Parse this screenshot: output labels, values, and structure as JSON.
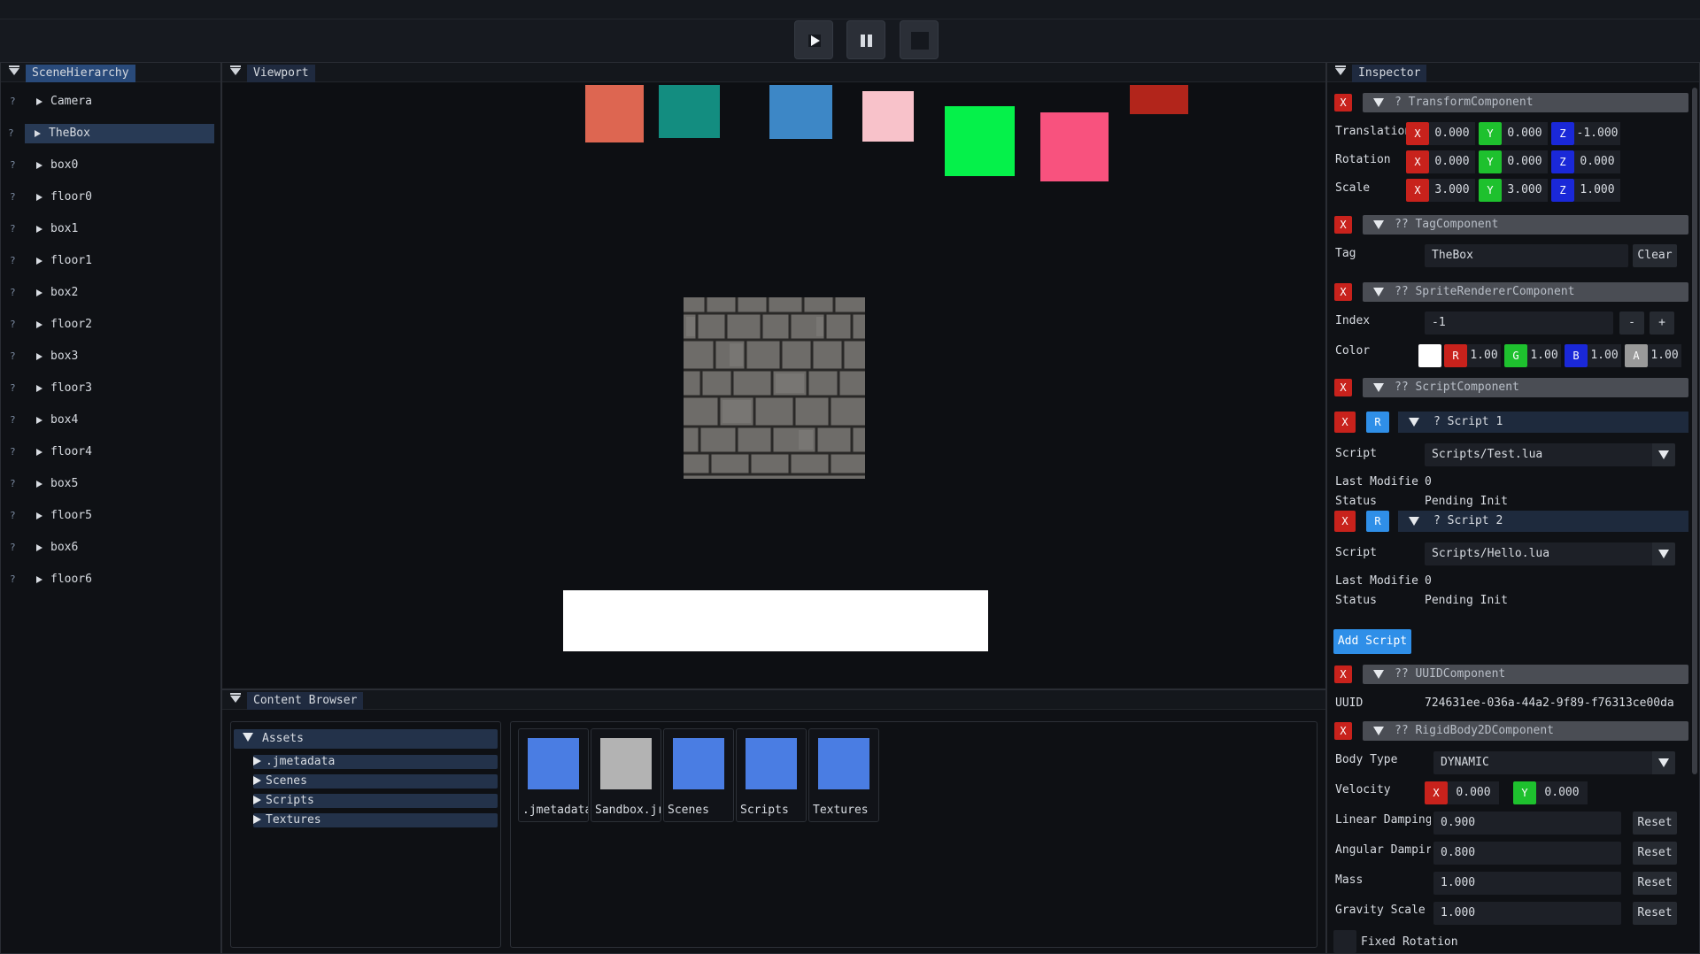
{
  "toolbar": {
    "buttons": [
      "play",
      "pause",
      "stop"
    ]
  },
  "hierarchy": {
    "tab": "SceneHierarchy",
    "row_marker": "?",
    "items": [
      "Camera",
      "TheBox",
      "box0",
      "floor0",
      "box1",
      "floor1",
      "box2",
      "floor2",
      "box3",
      "floor3",
      "box4",
      "floor4",
      "box5",
      "floor5",
      "box6",
      "floor6"
    ],
    "selected": "TheBox"
  },
  "viewport": {
    "tab": "Viewport",
    "colors": {
      "sq1": "#dd6651",
      "sq2": "#138d80",
      "sq3": "#3d87c6",
      "sq4": "#f8c2ca",
      "sq5": "#05f14a",
      "sq6": "#f8527e",
      "sq7": "#b2251b",
      "floor": "#ffffff"
    }
  },
  "content_browser": {
    "tab": "Content Browser",
    "tree": {
      "root": "Assets",
      "children": [
        ".jmetadata",
        "Scenes",
        "Scripts",
        "Textures"
      ]
    },
    "tiles": [
      {
        "label": ".jmetadata",
        "color": "#4a7de3"
      },
      {
        "label": "Sandbox.jreg",
        "color": "#b3b3b3"
      },
      {
        "label": "Scenes",
        "color": "#4a7de3"
      },
      {
        "label": "Scripts",
        "color": "#4a7de3"
      },
      {
        "label": "Textures",
        "color": "#4a7de3"
      }
    ]
  },
  "inspector": {
    "tab": "Inspector",
    "remove_label": "X",
    "transform": {
      "title": "? TransformComponent",
      "translation_label": "Translation",
      "rotation_label": "Rotation",
      "scale_label": "Scale",
      "axis_x": "X",
      "axis_y": "Y",
      "axis_z": "Z",
      "translation": [
        "0.000",
        "0.000",
        "-1.000"
      ],
      "rotation": [
        "0.000",
        "0.000",
        "0.000"
      ],
      "scale": [
        "3.000",
        "3.000",
        "1.000"
      ]
    },
    "tag": {
      "title": "?? TagComponent",
      "label": "Tag",
      "value": "TheBox",
      "clear": "Clear"
    },
    "sprite": {
      "title": "?? SpriteRendererComponent",
      "index_label": "Index",
      "index_value": "-1",
      "minus": "-",
      "plus": "+",
      "color_label": "Color",
      "r_label": "R",
      "g_label": "G",
      "b_label": "B",
      "a_label": "A",
      "r": "1.00",
      "g": "1.00",
      "b": "1.00",
      "a": "1.00"
    },
    "script": {
      "title": "?? ScriptComponent",
      "reload_label": "R",
      "script_label": "Script",
      "modified_label": "Last Modifie",
      "status_label": "Status",
      "scripts": [
        {
          "name": "? Script 1",
          "path": "Scripts/Test.lua",
          "modified": "0",
          "status": "Pending Init"
        },
        {
          "name": "? Script 2",
          "path": "Scripts/Hello.lua",
          "modified": "0",
          "status": "Pending Init"
        }
      ],
      "add_label": "Add Script"
    },
    "uuid": {
      "title": "?? UUIDComponent",
      "label": "UUID",
      "value": "724631ee-036a-44a2-9f89-f76313ce00da"
    },
    "rigidbody": {
      "title": "?? RigidBody2DComponent",
      "body_type_label": "Body Type",
      "body_type": "DYNAMIC",
      "velocity_label": "Velocity",
      "velocity_x": "0.000",
      "velocity_y": "0.000",
      "linear_damping_label": "Linear Damping",
      "linear_damping": "0.900",
      "angular_damping_label": "Angular Dampir",
      "angular_damping": "0.800",
      "mass_label": "Mass",
      "mass": "1.000",
      "gravity_label": "Gravity Scale",
      "gravity": "1.000",
      "reset_label": "Reset",
      "fixed_rotation_label": "Fixed Rotation"
    }
  }
}
